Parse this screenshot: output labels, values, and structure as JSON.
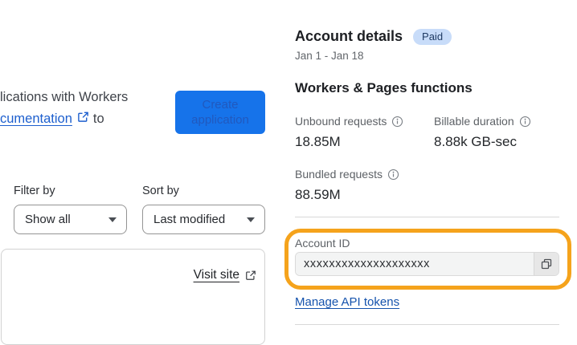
{
  "left_panel": {
    "intro": {
      "line1": "lications with Workers",
      "link_text": "cumentation",
      "suffix": "to"
    },
    "create_button": {
      "line1": "Create",
      "line2": "application"
    },
    "filter": {
      "label": "Filter by",
      "value": "Show all"
    },
    "sort": {
      "label": "Sort by",
      "value": "Last modified"
    },
    "site_card": {
      "visit_link": "Visit site"
    }
  },
  "account_panel": {
    "title": "Account details",
    "plan_badge": "Paid",
    "date_range": "Jan 1 - Jan 18",
    "usage_section": {
      "title": "Workers & Pages functions",
      "metrics": [
        {
          "label": "Unbound requests",
          "value": "18.85M"
        },
        {
          "label": "Billable duration",
          "value": "8.88k GB-sec"
        },
        {
          "label": "Bundled requests",
          "value": "88.59M"
        }
      ]
    },
    "account_id": {
      "label": "Account ID",
      "value": "xxxxxxxxxxxxxxxxxxxx"
    },
    "manage_api_tokens": "Manage API tokens"
  },
  "colors": {
    "accent_blue": "#1673ea",
    "link_blue": "#1d5fce",
    "badge_bg": "#c8dcf9",
    "badge_text": "#1f3a63",
    "highlight_orange": "#f5a31c"
  }
}
